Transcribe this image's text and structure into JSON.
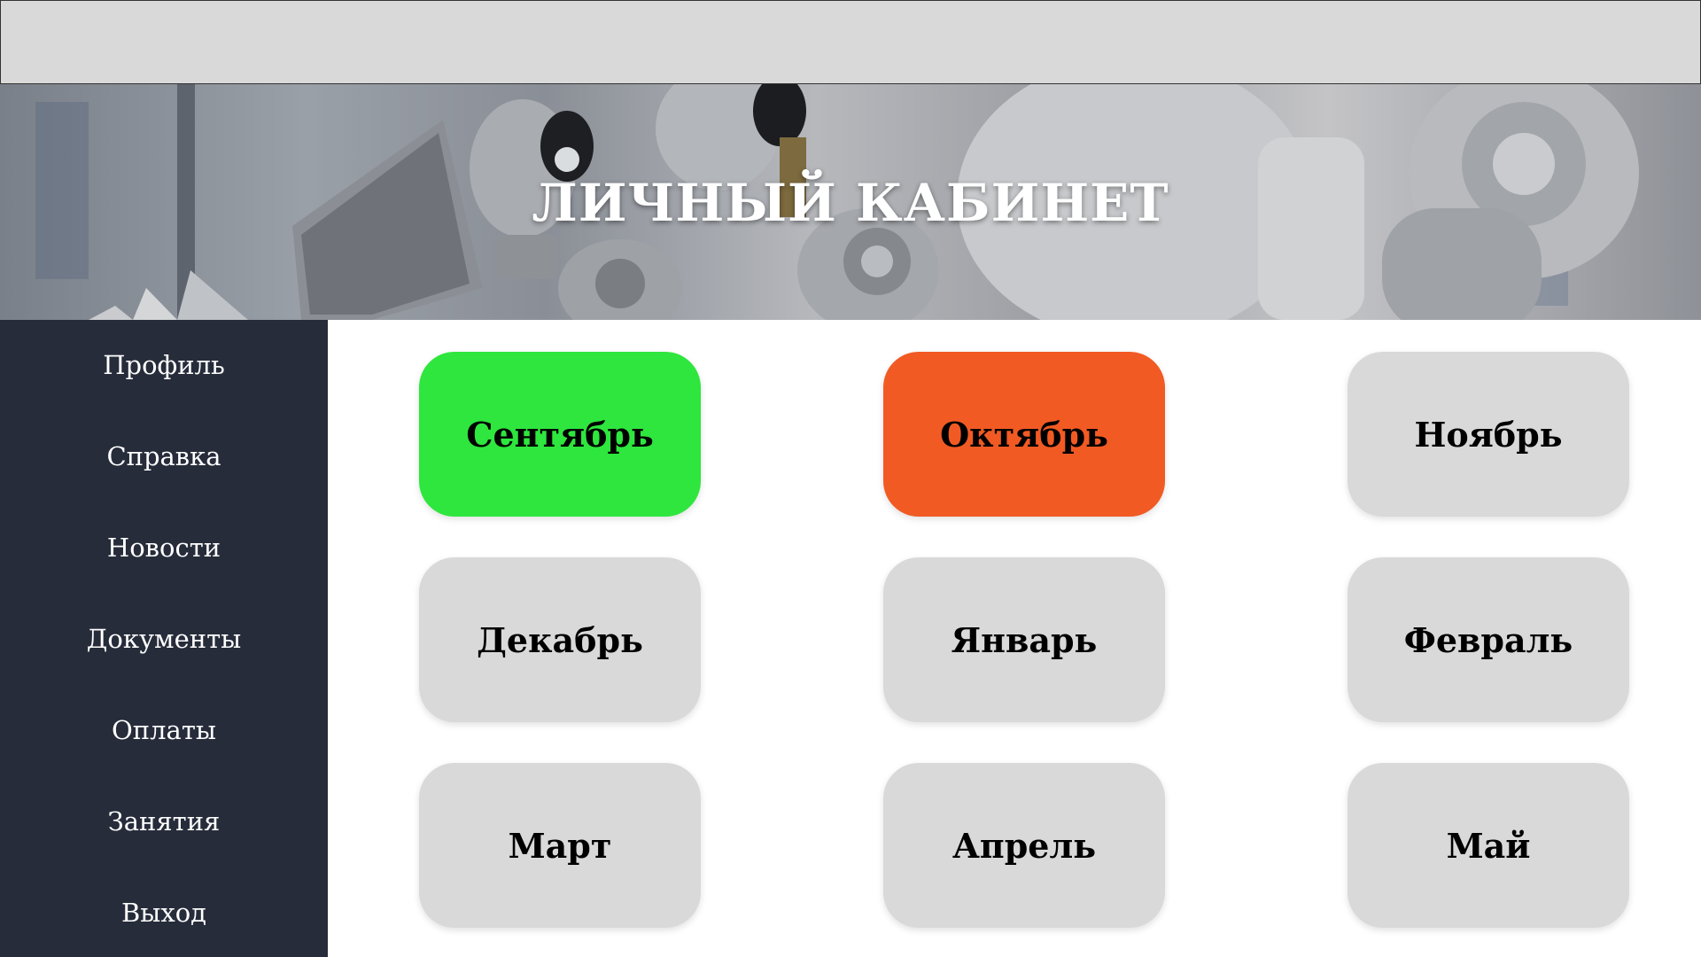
{
  "header": {
    "title": "ЛИЧНЫЙ КАБИНЕТ"
  },
  "sidebar": {
    "items": [
      {
        "label": "Профиль"
      },
      {
        "label": "Справка"
      },
      {
        "label": "Новости"
      },
      {
        "label": "Документы"
      },
      {
        "label": "Оплаты"
      },
      {
        "label": "Занятия"
      },
      {
        "label": "Выход"
      }
    ]
  },
  "months": [
    {
      "label": "Сентябрь",
      "status": "complete",
      "color": "#2ee63e"
    },
    {
      "label": "Октябрь",
      "status": "current",
      "color": "#f25a24"
    },
    {
      "label": "Ноябрь",
      "status": "inactive",
      "color": "#d9d9d9"
    },
    {
      "label": "Декабрь",
      "status": "inactive",
      "color": "#d9d9d9"
    },
    {
      "label": "Январь",
      "status": "inactive",
      "color": "#d9d9d9"
    },
    {
      "label": "Февраль",
      "status": "inactive",
      "color": "#d9d9d9"
    },
    {
      "label": "Март",
      "status": "inactive",
      "color": "#d9d9d9"
    },
    {
      "label": "Апрель",
      "status": "inactive",
      "color": "#d9d9d9"
    },
    {
      "label": "Май",
      "status": "inactive",
      "color": "#d9d9d9"
    }
  ],
  "colors": {
    "sidebar_bg": "#262c3a",
    "topbar_bg": "#d9d9d9",
    "inactive_month": "#d9d9d9"
  }
}
